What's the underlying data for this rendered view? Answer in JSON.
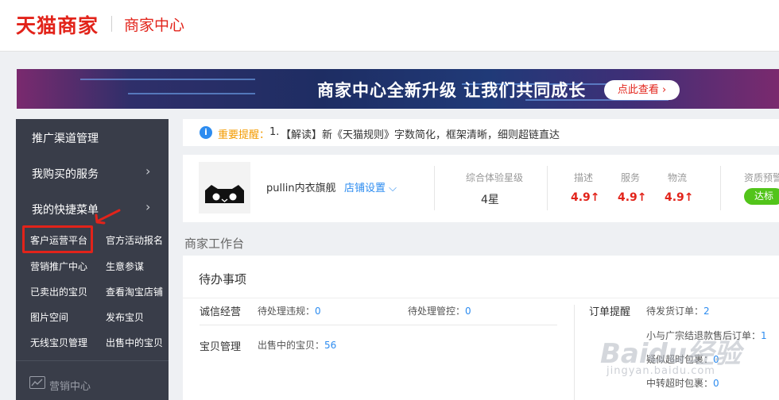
{
  "header": {
    "logo": "天猫商家",
    "subtitle": "商家中心"
  },
  "banner": {
    "text": "商家中心全新升级 让我们共同成长",
    "button": "点此查看 ›"
  },
  "sidebar": {
    "headings": [
      "推广渠道管理",
      "我购买的服务",
      "我的快捷菜单"
    ],
    "chevron": "›",
    "links": [
      [
        "客户运营平台",
        "官方活动报名"
      ],
      [
        "营销推广中心",
        "生意参谋"
      ],
      [
        "已卖出的宝贝",
        "查看淘宝店铺"
      ],
      [
        "图片空间",
        "发布宝贝"
      ],
      [
        "无线宝贝管理",
        "出售中的宝贝"
      ]
    ],
    "footer_label": "营销中心",
    "highlight_color": "#e2231a"
  },
  "notice": {
    "label": "重要提醒：",
    "index": "1.",
    "text": "【解读】新《天猫规则》字数简化，框架清晰，细则超链直达"
  },
  "shop": {
    "name": "pullin内衣旗舰",
    "settings": "店铺设置 ⌵",
    "rating_label": "综合体验星级",
    "rating_value": "4星",
    "scores": [
      {
        "label": "描述",
        "value": "4.9↑"
      },
      {
        "label": "服务",
        "value": "4.9↑"
      },
      {
        "label": "物流",
        "value": "4.9↑"
      }
    ],
    "qualification_label": "资质预警",
    "qualification_badge": "达标"
  },
  "workbench": {
    "title": "商家工作台",
    "todo_title": "待办事项",
    "rows": [
      {
        "label": "诚信经营",
        "items": [
          {
            "text": "待处理违规：",
            "count": "0"
          },
          {
            "text": "待处理管控：",
            "count": "0"
          }
        ]
      },
      {
        "label": "宝贝管理",
        "items": [
          {
            "text": "出售中的宝贝：",
            "count": "56"
          }
        ]
      }
    ],
    "orders": {
      "label": "订单提醒",
      "items": [
        {
          "text": "待发货订单：",
          "count": "2"
        },
        {
          "text": "小与广宗结退款售后订单：",
          "count": "1"
        },
        {
          "text": "疑似超时包裹：",
          "count": "0"
        },
        {
          "text": "中转超时包裹：",
          "count": "0"
        }
      ]
    }
  },
  "watermark": {
    "main": "Baidu经验",
    "sub": "jingyan.baidu.com"
  },
  "colors": {
    "brand": "#e2231a",
    "sidebar": "#393d49",
    "link": "#2d8cf0",
    "badge": "#52c41a"
  }
}
